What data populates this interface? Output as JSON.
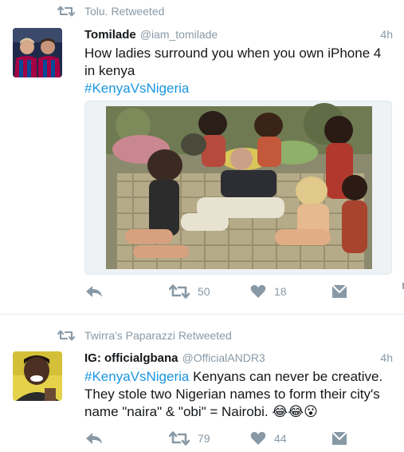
{
  "tweets": [
    {
      "retweeted_by": "Tolu. Retweeted",
      "display_name": "Tomilade",
      "handle": "@iam_tomilade",
      "time": "4h",
      "text_before": "How ladies surround you when you own iPhone 4 in kenya",
      "hashtag": "#KenyaVsNigeria",
      "has_media": true,
      "counts": {
        "retweets": "50",
        "likes": "18"
      },
      "icons": [
        "retweet-icon",
        "reply-icon",
        "like-icon",
        "message-icon"
      ]
    },
    {
      "retweeted_by": "Twirra's Paparazzi Retweeted",
      "display_name": "IG: officialgbana",
      "handle": "@OfficialANDR3",
      "time": "4h",
      "hashtag": "#KenyaVsNigeria",
      "text_after": " Kenyans can never be creative. They stole two Nigerian names to form their city's name \"naira\" & \"obi\" = Nairobi. 😂😂😮",
      "counts": {
        "retweets": "79",
        "likes": "44"
      }
    }
  ],
  "colors": {
    "accent": "#1b95e0",
    "muted": "#8899a6",
    "text": "#14171a",
    "divider": "#e6ecf0"
  }
}
